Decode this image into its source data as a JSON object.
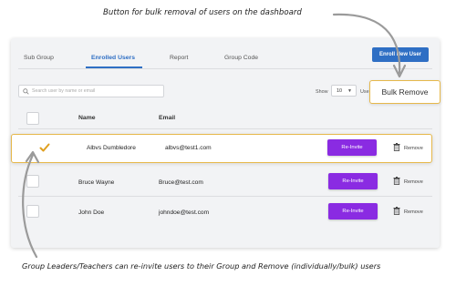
{
  "annotations": {
    "top": "Button for bulk removal of users on the dashboard",
    "bottom": "Group Leaders/Teachers can re-invite users to their Group and Remove (individually/bulk) users"
  },
  "tabs": [
    {
      "label": "Sub Group",
      "active": false
    },
    {
      "label": "Enrolled Users",
      "active": true
    },
    {
      "label": "Report",
      "active": false
    },
    {
      "label": "Group Code",
      "active": false
    }
  ],
  "enroll_button": "Enroll New User",
  "search": {
    "placeholder": "Search user by name or email",
    "value": ""
  },
  "pagination": {
    "show_label": "Show",
    "page_size": "10",
    "users_label": "Users"
  },
  "bulk_remove_label": "Bulk Remove",
  "table": {
    "headers": {
      "name": "Name",
      "email": "Email"
    },
    "rows": [
      {
        "name": "Albvs Dumbledore",
        "email": "albvs@test1.com",
        "selected": true,
        "reinvite": "Re-Invite",
        "remove": "Remove"
      },
      {
        "name": "Bruce Wayne",
        "email": "Bruce@test.com",
        "selected": false,
        "reinvite": "Re-Invite",
        "remove": "Remove"
      },
      {
        "name": "John Doe",
        "email": "johndoe@test.com",
        "selected": false,
        "reinvite": "Re-Invite",
        "remove": "Remove"
      }
    ]
  },
  "colors": {
    "accent": "#2f6fc4",
    "reinvite": "#8a2be2",
    "highlight": "#e6b84a",
    "check": "#e0a020"
  },
  "icons": [
    "search-icon",
    "chevron-down-icon",
    "check-icon",
    "trash-icon",
    "curved-arrow-icon"
  ]
}
